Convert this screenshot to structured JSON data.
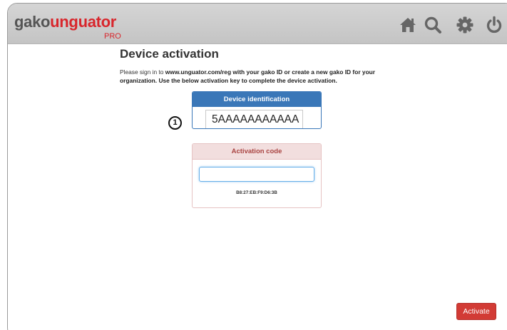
{
  "brand": {
    "name_part1": "gako",
    "name_part2": "unguator",
    "edition": "PRO"
  },
  "nav": {
    "icons": [
      "home-icon",
      "search-icon",
      "gear-icon",
      "power-icon"
    ]
  },
  "page": {
    "title": "Device activation",
    "intro_plain": "Please sign in to ",
    "intro_bold": "www.unguator.com/reg with your gako ID or create a new gako ID for your organization. Use the below activation key to complete the device activation."
  },
  "step": {
    "number": "1"
  },
  "device_identification": {
    "header": "Device identification",
    "value": "5AAAAAAAAAAA"
  },
  "activation_code": {
    "header": "Activation code",
    "input_value": "",
    "key": "B8:27:EB:F9:D6:3B"
  },
  "actions": {
    "activate_label": "Activate"
  },
  "colors": {
    "brand_red": "#d8262c",
    "header_blue": "#3a77b8",
    "activation_header_bg": "#f2dede",
    "activation_header_text": "#a94442",
    "activate_button": "#d23b35"
  }
}
